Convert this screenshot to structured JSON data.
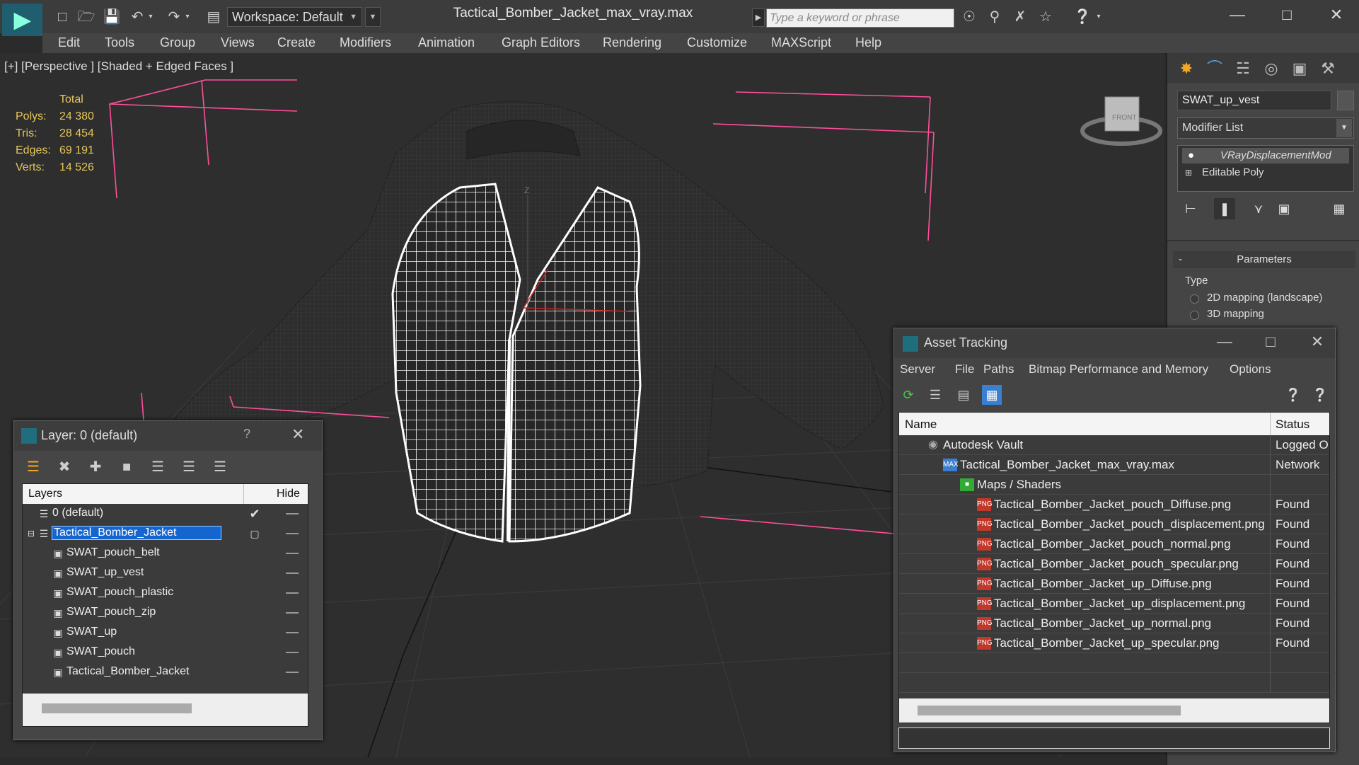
{
  "titlebar": {
    "workspace": "Workspace: Default",
    "document_title": "Tactical_Bomber_Jacket_max_vray.max",
    "search_placeholder": "Type a keyword or phrase"
  },
  "menu": [
    "Edit",
    "Tools",
    "Group",
    "Views",
    "Create",
    "Modifiers",
    "Animation",
    "Graph Editors",
    "Rendering",
    "Customize",
    "MAXScript",
    "Help"
  ],
  "viewport": {
    "label": "[+] [Perspective ] [Shaded + Edged Faces ]",
    "stats": {
      "header": "Total",
      "rows": [
        {
          "label": "Polys:",
          "value": "24 380"
        },
        {
          "label": "Tris:",
          "value": "28 454"
        },
        {
          "label": "Edges:",
          "value": "69 191"
        },
        {
          "label": "Verts:",
          "value": "14 526"
        }
      ]
    },
    "viewcube_label": "FRONT",
    "axis_label": "Z"
  },
  "command_panel": {
    "object_name": "SWAT_up_vest",
    "modifier_list": "Modifier List",
    "stack": [
      "VRayDisplacementMod",
      "Editable Poly"
    ],
    "params_title": "Parameters",
    "type_label": "Type",
    "type_options": [
      "2D mapping (landscape)",
      "3D mapping"
    ]
  },
  "layer_window": {
    "title": "Layer: 0 (default)",
    "help": "?",
    "col_layers": "Layers",
    "col_hide": "Hide",
    "rows": [
      {
        "name": "0 (default)",
        "level": 0,
        "checked": true,
        "selected": false
      },
      {
        "name": "Tactical_Bomber_Jacket",
        "level": 0,
        "checked": false,
        "selected": true
      },
      {
        "name": "SWAT_pouch_belt",
        "level": 1,
        "checked": false,
        "selected": false
      },
      {
        "name": "SWAT_up_vest",
        "level": 1,
        "checked": false,
        "selected": false
      },
      {
        "name": "SWAT_pouch_plastic",
        "level": 1,
        "checked": false,
        "selected": false
      },
      {
        "name": "SWAT_pouch_zip",
        "level": 1,
        "checked": false,
        "selected": false
      },
      {
        "name": "SWAT_up",
        "level": 1,
        "checked": false,
        "selected": false
      },
      {
        "name": "SWAT_pouch",
        "level": 1,
        "checked": false,
        "selected": false
      },
      {
        "name": "Tactical_Bomber_Jacket",
        "level": 1,
        "checked": false,
        "selected": false
      }
    ]
  },
  "asset_window": {
    "title": "Asset Tracking",
    "menu": [
      "Server",
      "File",
      "Paths",
      "Bitmap Performance and Memory",
      "Options"
    ],
    "col_name": "Name",
    "col_status": "Status",
    "rows": [
      {
        "name": "Autodesk Vault",
        "status": "Logged O",
        "level": 1,
        "icon": "vault-icon"
      },
      {
        "name": "Tactical_Bomber_Jacket_max_vray.max",
        "status": "Network",
        "level": 2,
        "icon": "max-file-icon"
      },
      {
        "name": "Maps / Shaders",
        "status": "",
        "level": 3,
        "icon": "maps-folder-icon"
      },
      {
        "name": "Tactical_Bomber_Jacket_pouch_Diffuse.png",
        "status": "Found",
        "level": 4,
        "icon": "png-icon"
      },
      {
        "name": "Tactical_Bomber_Jacket_pouch_displacement.png",
        "status": "Found",
        "level": 4,
        "icon": "png-icon"
      },
      {
        "name": "Tactical_Bomber_Jacket_pouch_normal.png",
        "status": "Found",
        "level": 4,
        "icon": "png-icon"
      },
      {
        "name": "Tactical_Bomber_Jacket_pouch_specular.png",
        "status": "Found",
        "level": 4,
        "icon": "png-icon"
      },
      {
        "name": "Tactical_Bomber_Jacket_up_Diffuse.png",
        "status": "Found",
        "level": 4,
        "icon": "png-icon"
      },
      {
        "name": "Tactical_Bomber_Jacket_up_displacement.png",
        "status": "Found",
        "level": 4,
        "icon": "png-icon"
      },
      {
        "name": "Tactical_Bomber_Jacket_up_normal.png",
        "status": "Found",
        "level": 4,
        "icon": "png-icon"
      },
      {
        "name": "Tactical_Bomber_Jacket_up_specular.png",
        "status": "Found",
        "level": 4,
        "icon": "png-icon"
      }
    ]
  },
  "colors": {
    "stats_yellow": "#e6c75a",
    "selection_blue": "#1565d0",
    "bounding_pink": "#ff4f9a",
    "png_red": "#c0392b"
  }
}
